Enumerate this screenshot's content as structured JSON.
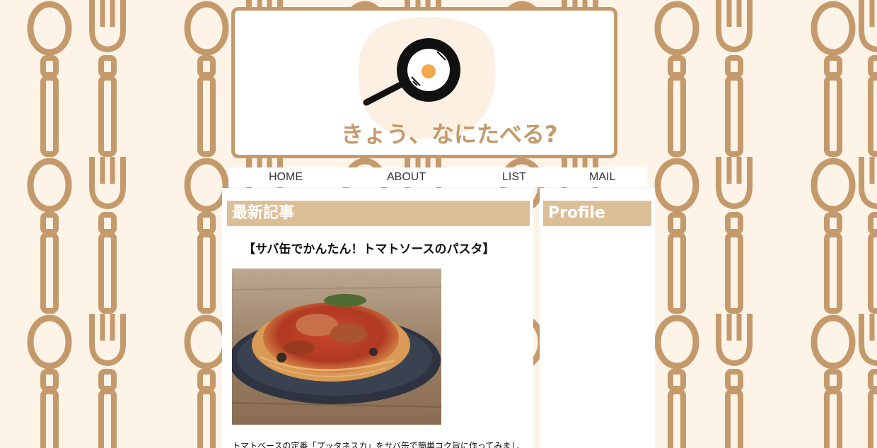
{
  "site": {
    "title": "きょう、なにたべる?"
  },
  "nav": {
    "items": [
      {
        "label": "HOME"
      },
      {
        "label": "ABOUT"
      },
      {
        "label": "LIST"
      },
      {
        "label": "MAIL"
      }
    ]
  },
  "main": {
    "section_title": "最新記事",
    "article": {
      "title": "【サバ缶でかんたん！トマトソースのパスタ】",
      "excerpt": "トマトベースの定番「プッタネスカ」をサバ缶で簡単コク旨に作ってみまし"
    }
  },
  "sidebar": {
    "section_title": "Profile"
  },
  "colors": {
    "background": "#fdf3e7",
    "pattern": "#c49a6c",
    "header_band": "#dcbf98",
    "accent_egg": "#f2a94b"
  },
  "icons": {
    "logo": "frying-pan-egg-icon",
    "background_pattern": "spoon-fork-pattern-icon"
  }
}
